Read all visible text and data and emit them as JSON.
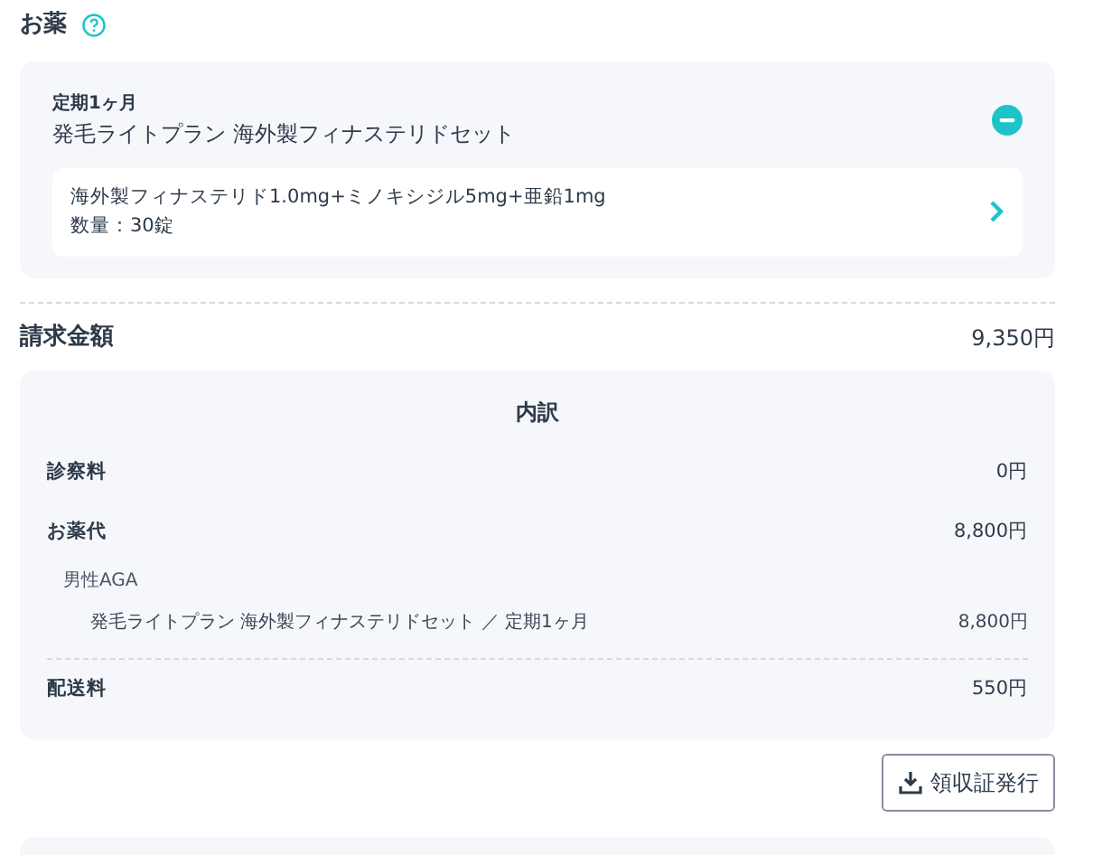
{
  "section": {
    "title": "お薬"
  },
  "plan": {
    "term": "定期1ヶ月",
    "name": "発毛ライトプラン 海外製フィナステリドセット",
    "expanded": true,
    "item": {
      "description": "海外製フィナステリド1.0mg+ミノキシジル5mg+亜鉛1mg",
      "quantity": "数量：30錠"
    }
  },
  "billing": {
    "label": "請求金額",
    "amount": "9,350円"
  },
  "breakdown": {
    "title": "内訳",
    "rows": [
      {
        "kind": "main",
        "label": "診察料",
        "amount": "0円"
      },
      {
        "kind": "main",
        "label": "お薬代",
        "amount": "8,800円"
      },
      {
        "kind": "category",
        "label": "男性AGA"
      },
      {
        "kind": "item",
        "label": "発毛ライトプラン 海外製フィナステリドセット ／ 定期1ヶ月",
        "amount": "8,800円"
      },
      {
        "kind": "main",
        "label": "配送料",
        "amount": "550円"
      }
    ]
  },
  "receipt_button": "領収証発行"
}
